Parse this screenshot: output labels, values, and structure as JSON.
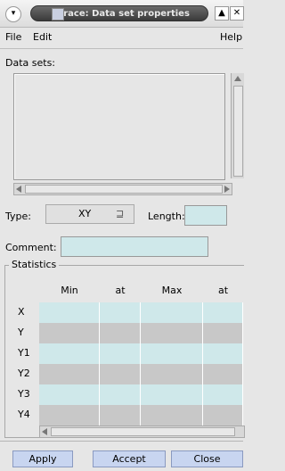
{
  "titlebar": {
    "title": "Grace: Data set properties",
    "menu_icon": "chevron-down-icon",
    "shade_glyph": "▲",
    "close_glyph": "✕"
  },
  "menu": {
    "file": "File",
    "edit": "Edit",
    "help": "Help"
  },
  "datasets": {
    "label": "Data sets:",
    "items": []
  },
  "type": {
    "label": "Type:",
    "value": "XY",
    "glyph": "⊒"
  },
  "length": {
    "label": "Length:",
    "value": ""
  },
  "comment": {
    "label": "Comment:",
    "value": ""
  },
  "statistics": {
    "label": "Statistics",
    "columns": [
      "Min",
      "at",
      "Max",
      "at"
    ],
    "rows": [
      {
        "label": "X",
        "values": [
          "",
          "",
          "",
          ""
        ]
      },
      {
        "label": "Y",
        "values": [
          "",
          "",
          "",
          ""
        ]
      },
      {
        "label": "Y1",
        "values": [
          "",
          "",
          "",
          ""
        ]
      },
      {
        "label": "Y2",
        "values": [
          "",
          "",
          "",
          ""
        ]
      },
      {
        "label": "Y3",
        "values": [
          "",
          "",
          "",
          ""
        ]
      },
      {
        "label": "Y4",
        "values": [
          "",
          "",
          "",
          ""
        ]
      }
    ]
  },
  "buttons": {
    "apply": "Apply",
    "accept": "Accept",
    "close": "Close"
  },
  "colors": {
    "cell_light": "#cfe8ea",
    "cell_dark": "#c8c8c8",
    "button": "#c8d5f0"
  }
}
